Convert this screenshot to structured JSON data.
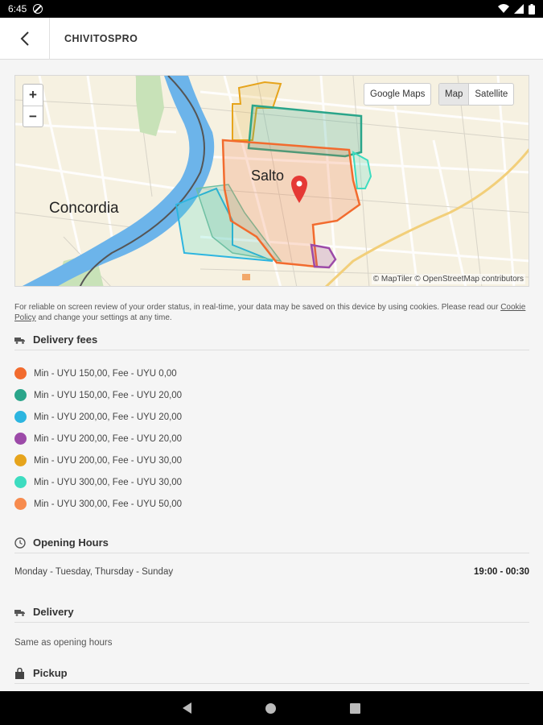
{
  "status_bar": {
    "time": "6:45"
  },
  "app_bar": {
    "title": "CHIVITOSPRO"
  },
  "map": {
    "zoom_in": "+",
    "zoom_out": "−",
    "google_maps_label": "Google Maps",
    "map_type": {
      "map": "Map",
      "satellite": "Satellite"
    },
    "labels": {
      "city_main": "Salto",
      "city_other": "Concordia"
    },
    "attribution": "© MapTiler © OpenStreetMap contributors"
  },
  "cookie_notice": {
    "text": "For reliable on screen review of your order status, in real-time, your data may be saved on this device by using cookies. Please read our",
    "link": "Cookie Policy",
    "suffix": " and change your settings at any time."
  },
  "delivery_fees": {
    "title": "Delivery fees",
    "items": [
      {
        "label": "Min - UYU 150,00, Fee - UYU 0,00",
        "color": "#f26b2e"
      },
      {
        "label": "Min - UYU 150,00, Fee - UYU 20,00",
        "color": "#2aa58a"
      },
      {
        "label": "Min - UYU 200,00, Fee - UYU 20,00",
        "color": "#2cb5e0"
      },
      {
        "label": "Min - UYU 200,00, Fee - UYU 20,00",
        "color": "#9c4aa8"
      },
      {
        "label": "Min - UYU 200,00, Fee - UYU 30,00",
        "color": "#e6a41c"
      },
      {
        "label": "Min - UYU 300,00, Fee - UYU 30,00",
        "color": "#3ddcc0"
      },
      {
        "label": "Min - UYU 300,00, Fee - UYU 50,00",
        "color": "#f78b4e"
      }
    ]
  },
  "opening_hours": {
    "title": "Opening Hours",
    "days": "Monday - Tuesday, Thursday - Sunday",
    "time": "19:00 - 00:30"
  },
  "delivery": {
    "title": "Delivery",
    "text": "Same as opening hours"
  },
  "pickup": {
    "title": "Pickup"
  }
}
